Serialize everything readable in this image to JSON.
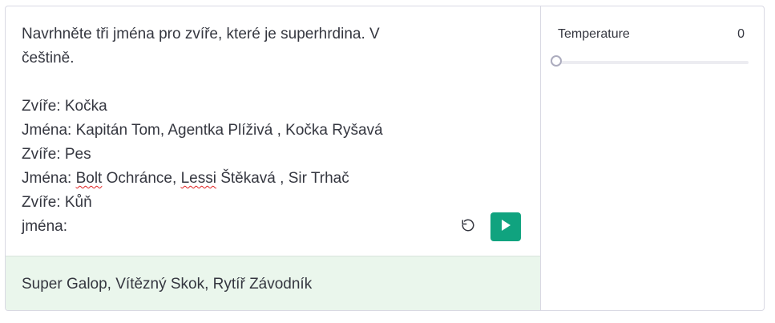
{
  "prompt": {
    "lines": [
      [
        "Navrhněte tři jména pro zvíře, které je superhrdina. V"
      ],
      [
        "češtině."
      ],
      [
        ""
      ],
      [
        "Zvíře: Kočka"
      ],
      [
        "Jména: Kapitán Tom, Agentka Plíživá , Kočka Ryšavá"
      ],
      [
        "Zvíře: Pes"
      ],
      [
        "Jména: ",
        "Bolt",
        " Ochránce, ",
        "Lessi",
        " Štěkavá , Sir Trhač"
      ],
      [
        "Zvíře: Kůň"
      ],
      [
        "jména:"
      ]
    ]
  },
  "completion": {
    "text": "Super Galop, Vítězný Skok, Rytíř Závodník"
  },
  "controls": {
    "regenerate_icon": "undo-icon",
    "submit_icon": "play-icon",
    "submit_color": "#10a37f"
  },
  "settings": {
    "temperature_label": "Temperature",
    "temperature_value": "0",
    "temperature_fraction": 0
  },
  "colors": {
    "completion_bg": "#eaf6ec",
    "accent": "#10a37f"
  }
}
